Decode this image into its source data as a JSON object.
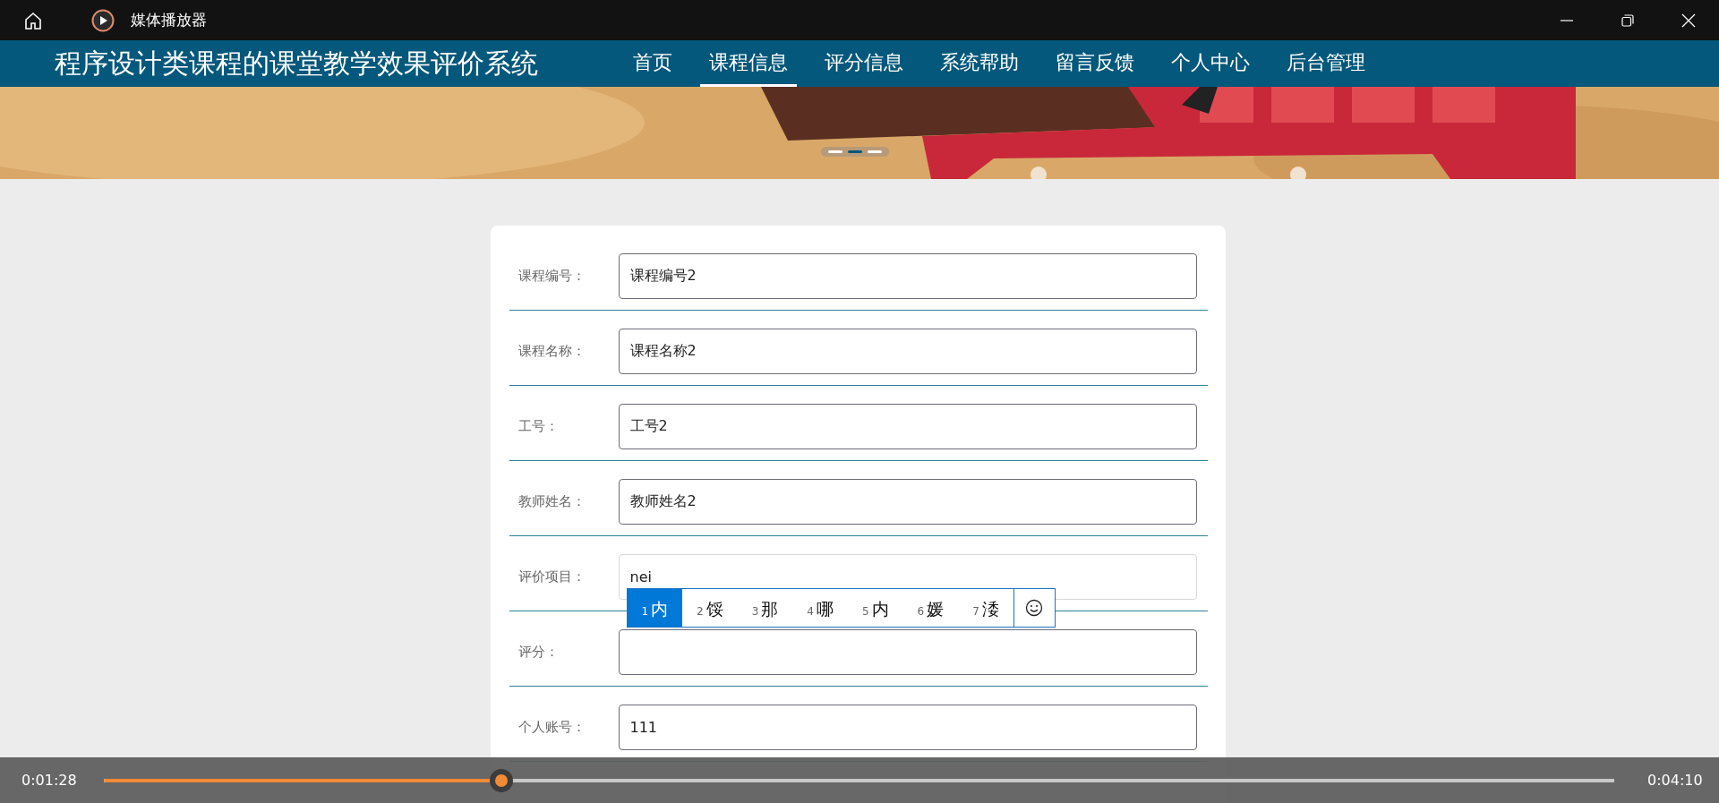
{
  "window": {
    "title": "媒体播放器"
  },
  "site": {
    "title": "程序设计类课程的课堂教学效果评价系统",
    "nav": [
      {
        "label": "首页",
        "selected": false
      },
      {
        "label": "课程信息",
        "selected": true
      },
      {
        "label": "评分信息",
        "selected": false
      },
      {
        "label": "系统帮助",
        "selected": false
      },
      {
        "label": "留言反馈",
        "selected": false
      },
      {
        "label": "个人中心",
        "selected": false
      },
      {
        "label": "后台管理",
        "selected": false
      }
    ]
  },
  "banner": {
    "kind": "picture",
    "slides": [
      {
        "selected": false
      },
      {
        "selected": true
      },
      {
        "selected": false
      }
    ]
  },
  "form": {
    "rows": [
      {
        "label": "课程编号：",
        "value": "课程编号2",
        "focused": false
      },
      {
        "label": "课程名称：",
        "value": "课程名称2",
        "focused": false
      },
      {
        "label": "工号：",
        "value": "工号2",
        "focused": false
      },
      {
        "label": "教师姓名：",
        "value": "教师姓名2",
        "focused": false
      },
      {
        "label": "评价项目：",
        "value": "nei",
        "focused": true
      },
      {
        "label": "评分：",
        "value": "",
        "focused": false
      },
      {
        "label": "个人账号：",
        "value": "111",
        "focused": false
      }
    ]
  },
  "ime": {
    "candidates": [
      {
        "index": "1",
        "text": "内",
        "selected": true
      },
      {
        "index": "2",
        "text": "馁",
        "selected": false
      },
      {
        "index": "3",
        "text": "那",
        "selected": false
      },
      {
        "index": "4",
        "text": "哪",
        "selected": false
      },
      {
        "index": "5",
        "text": "内",
        "selected": false
      },
      {
        "index": "6",
        "text": "媛",
        "selected": false
      },
      {
        "index": "7",
        "text": "涹",
        "selected": false
      }
    ]
  },
  "player": {
    "elapsed": "0:01:28",
    "total": "0:04:10",
    "level": 0.263
  }
}
